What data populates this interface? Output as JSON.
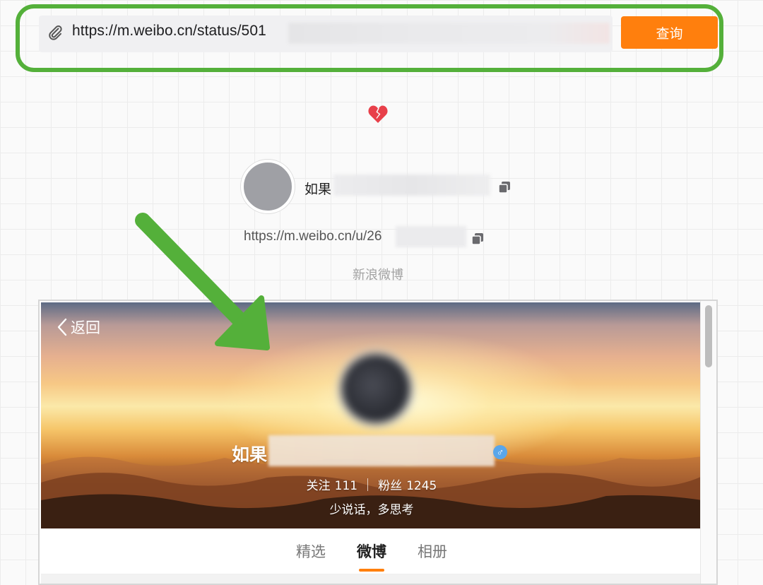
{
  "query": {
    "url_value": "https://m.weibo.cn/status/501",
    "button_label": "查询",
    "highlight_color": "#54b03a",
    "button_color": "#ff7f0d"
  },
  "profile": {
    "username_prefix": "如果",
    "profile_url": "https://m.weibo.cn/u/26",
    "source": "新浪微博"
  },
  "embed": {
    "back_label": "返回",
    "name_prefix": "如果",
    "gender_symbol": "♂",
    "following_label": "关注",
    "following_count": "111",
    "followers_label": "粉丝",
    "followers_count": "1245",
    "bio": "少说话，多思考",
    "tabs": [
      {
        "label": "精选"
      },
      {
        "label": "微博"
      },
      {
        "label": "相册"
      }
    ],
    "active_tab_index": 1
  },
  "icons": [
    "paperclip-icon",
    "broken-heart-icon",
    "copy-icon",
    "back-chevron-icon",
    "male-gender-icon"
  ]
}
